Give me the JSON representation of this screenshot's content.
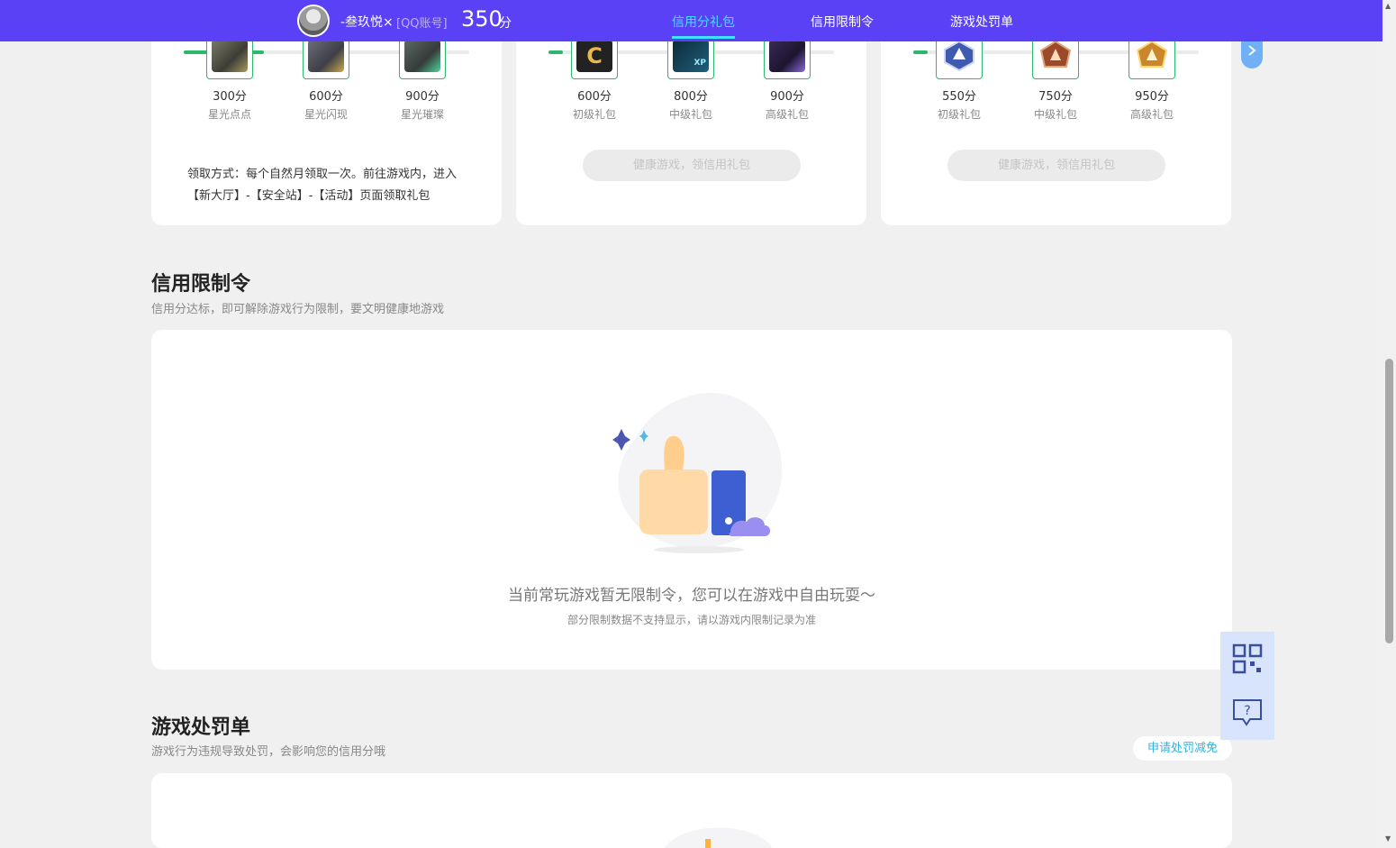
{
  "header": {
    "username": "-叁玖悦×",
    "account_type": "[QQ账号]",
    "score": "350",
    "score_unit": "分",
    "tabs": [
      {
        "label": "信用分礼包",
        "active": true
      },
      {
        "label": "信用限制令",
        "active": false
      },
      {
        "label": "游戏处罚单",
        "active": false
      }
    ]
  },
  "gift_cards": [
    {
      "progress": 0.28,
      "tiers": [
        {
          "points": "300分",
          "label": "星光点点",
          "icon": "armor-set-icon"
        },
        {
          "points": "600分",
          "label": "星光闪现",
          "icon": "armor-set-icon"
        },
        {
          "points": "900分",
          "label": "星光璀璨",
          "icon": "armor-set-icon"
        }
      ],
      "description": "领取方式：每个自然月领取一次。前往游戏内，进入【新大厅】-【安全站】-【活动】页面领取礼包"
    },
    {
      "progress": 0.05,
      "tiers": [
        {
          "points": "600分",
          "label": "初级礼包",
          "icon": "c-badge-icon"
        },
        {
          "points": "800分",
          "label": "中级礼包",
          "icon": "xp-gun-card-icon"
        },
        {
          "points": "900分",
          "label": "高级礼包",
          "icon": "purple-crate-icon"
        }
      ],
      "button_label": "健康游戏，领信用礼包"
    },
    {
      "progress": 0.05,
      "tiers": [
        {
          "points": "550分",
          "label": "初级礼包",
          "icon": "blue-rank-badge-icon"
        },
        {
          "points": "750分",
          "label": "中级礼包",
          "icon": "bronze-rank-badge-icon"
        },
        {
          "points": "950分",
          "label": "高级礼包",
          "icon": "gold-rank-badge-icon"
        }
      ],
      "button_label": "健康游戏，领信用礼包"
    }
  ],
  "restriction": {
    "title": "信用限制令",
    "subtitle": "信用分达标，即可解除游戏行为限制，要文明健康地游戏",
    "empty_message": "当前常玩游戏暂无限制令，您可以在游戏中自由玩耍～",
    "empty_note": "部分限制数据不支持显示，请以游戏内限制记录为准"
  },
  "penalty": {
    "title": "游戏处罚单",
    "subtitle": "游戏行为违规导致处罚，会影响您的信用分哦",
    "apply_button": "申请处罚减免"
  },
  "side_tools": [
    "qr-code-icon",
    "help-chat-icon"
  ],
  "colors": {
    "nav_bg": "#5b41f6",
    "nav_active": "#3ee3ff",
    "progress": "#2cb86c",
    "accent_link": "#2fb4e0"
  }
}
